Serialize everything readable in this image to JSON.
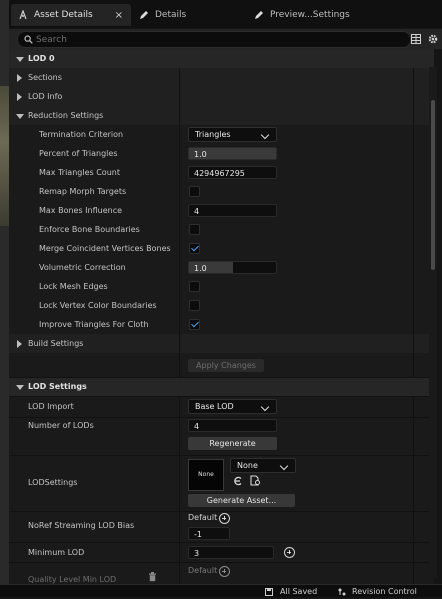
{
  "tabs": [
    {
      "label": "Asset Details",
      "icon": "asset-details-icon",
      "active": true,
      "close": "×"
    },
    {
      "label": "Details",
      "icon": "pencil-icon",
      "active": false
    },
    {
      "label": "Preview...Settings",
      "icon": "pencil-icon",
      "active": false
    }
  ],
  "search": {
    "placeholder": "Search"
  },
  "sections": {
    "lod0": "LOD 0",
    "sections": "Sections",
    "lod_info": "LOD Info",
    "reduction": "Reduction Settings",
    "build": "Build Settings",
    "lod_settings": "LOD Settings"
  },
  "reduction": {
    "termination_label": "Termination Criterion",
    "termination_value": "Triangles",
    "percent_label": "Percent of Triangles",
    "percent_value": "1.0",
    "max_tri_label": "Max Triangles Count",
    "max_tri_value": "4294967295",
    "remap_label": "Remap Morph Targets",
    "remap_checked": false,
    "max_bones_label": "Max Bones Influence",
    "max_bones_value": "4",
    "enforce_label": "Enforce Bone Boundaries",
    "enforce_checked": false,
    "merge_label": "Merge Coincident Vertices Bones",
    "merge_checked": true,
    "volumetric_label": "Volumetric Correction",
    "volumetric_value": "1.0",
    "volumetric_fraction": 0.5,
    "lock_edges_label": "Lock Mesh Edges",
    "lock_edges_checked": false,
    "lock_color_label": "Lock Vertex Color Boundaries",
    "lock_color_checked": false,
    "improve_label": "Improve Triangles For Cloth",
    "improve_checked": true
  },
  "apply_changes": "Apply Changes",
  "lod_settings": {
    "import_label": "LOD Import",
    "import_value": "Base LOD",
    "num_lods_label": "Number of LODs",
    "num_lods_value": "4",
    "regenerate": "Regenerate",
    "lodsettings_label": "LODSettings",
    "thumb_text": "None",
    "asset_value": "None",
    "generate_asset": "Generate Asset...",
    "noref_label": "NoRef Streaming LOD Bias",
    "noref_default": "Default",
    "noref_value": "-1",
    "min_lod_label": "Minimum LOD",
    "min_lod_value": "3",
    "quality_label": "Quality Level Min LOD",
    "quality_default": "Default"
  },
  "bottom": {
    "all_saved": "All Saved",
    "revision_control": "Revision Control"
  }
}
